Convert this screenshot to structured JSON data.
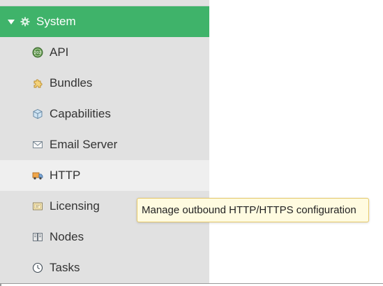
{
  "sidebar": {
    "section": {
      "label": "System",
      "icon": "gear-icon",
      "expanded": true,
      "color": "#3fb36a"
    },
    "items": [
      {
        "label": "API",
        "icon": "api-badge-icon"
      },
      {
        "label": "Bundles",
        "icon": "puzzle-piece-icon"
      },
      {
        "label": "Capabilities",
        "icon": "cube-icon"
      },
      {
        "label": "Email Server",
        "icon": "envelope-icon"
      },
      {
        "label": "HTTP",
        "icon": "truck-icon",
        "hovered": true
      },
      {
        "label": "Licensing",
        "icon": "certificate-icon"
      },
      {
        "label": "Nodes",
        "icon": "server-icon"
      },
      {
        "label": "Tasks",
        "icon": "clock-icon"
      }
    ]
  },
  "tooltip": {
    "text": "Manage outbound HTTP/HTTPS configuration"
  }
}
